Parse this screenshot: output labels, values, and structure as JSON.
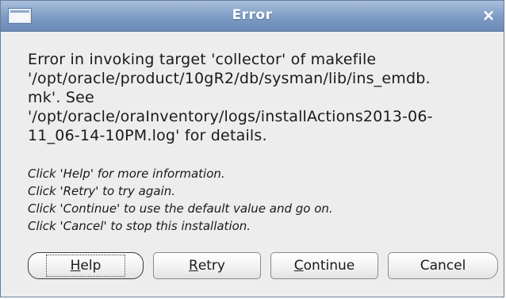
{
  "window": {
    "title": "Error",
    "close_glyph": "×"
  },
  "message": {
    "lines": [
      "Error in invoking target 'collector' of makefile",
      "'/opt/oracle/product/10gR2/db/sysman/lib/ins_emdb.",
      "mk'. See",
      "'/opt/oracle/oraInventory/logs/installActions2013-06-",
      "11_06-14-10PM.log' for details."
    ]
  },
  "hints": [
    "Click 'Help' for more information.",
    "Click 'Retry' to try again.",
    "Click 'Continue' to use the default value and go on.",
    "Click 'Cancel' to stop this installation."
  ],
  "buttons": {
    "help": {
      "mnemonic": "H",
      "rest": "elp"
    },
    "retry": {
      "mnemonic": "R",
      "rest": "etry"
    },
    "continue": {
      "mnemonic": "C",
      "rest": "ontinue"
    },
    "cancel": {
      "label": "Cancel"
    }
  },
  "colors": {
    "titlebar": "#7d9bc4",
    "dialog_bg": "#ededed"
  },
  "icons": {
    "window_icon": "window-icon",
    "close_icon": "close-icon"
  }
}
